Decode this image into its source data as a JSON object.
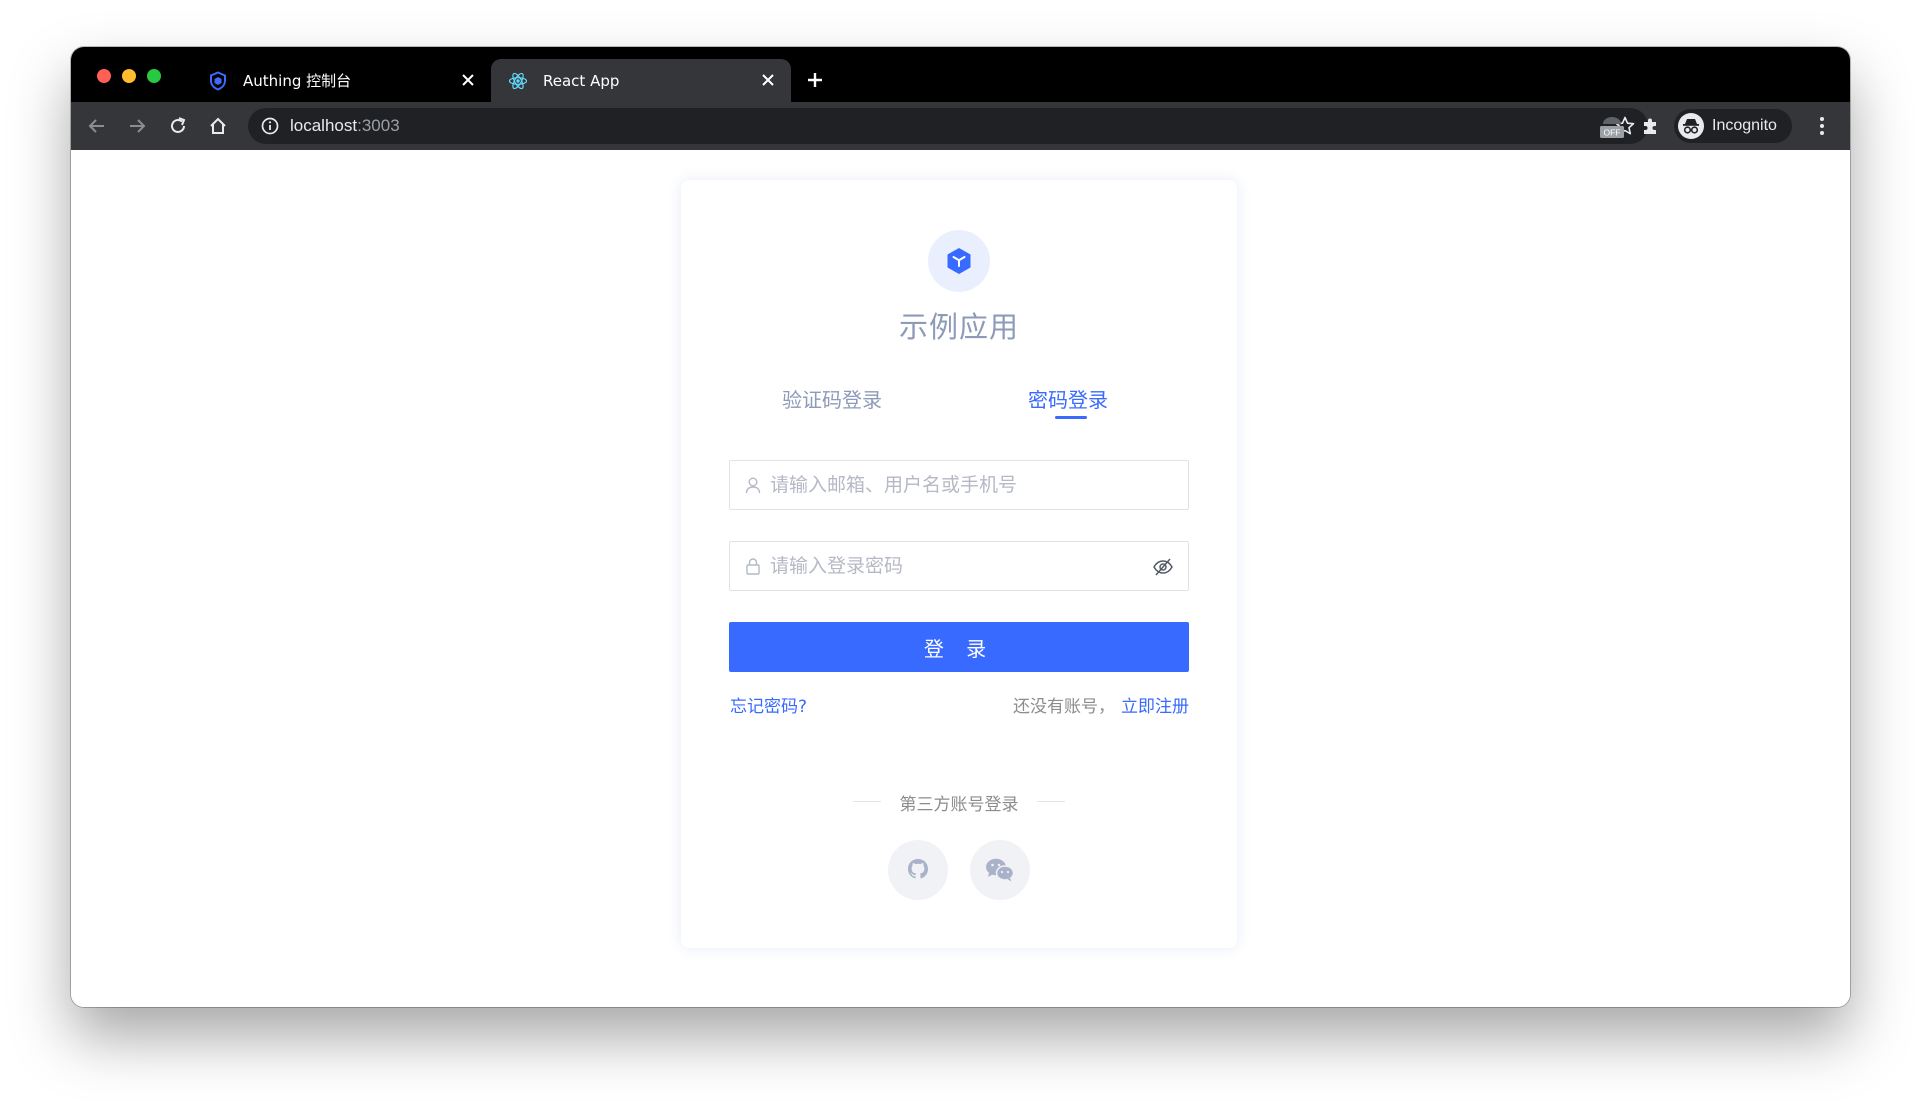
{
  "browser": {
    "tabs": [
      {
        "title": "Authing 控制台",
        "icon": "shield-icon",
        "active": false
      },
      {
        "title": "React App",
        "icon": "react-icon",
        "active": true
      }
    ],
    "url_host": "localhost",
    "url_port": ":3003",
    "profile_label": "Incognito",
    "extension_badge": "OFF"
  },
  "login": {
    "app_name": "示例应用",
    "tabs": {
      "sms": "验证码登录",
      "password": "密码登录"
    },
    "active_tab": "password",
    "username_placeholder": "请输入邮箱、用户名或手机号",
    "password_placeholder": "请输入登录密码",
    "submit_label": "登 录",
    "forgot_label": "忘记密码?",
    "no_account_label": "还没有账号，",
    "register_label": "立即注册",
    "third_party_label": "第三方账号登录",
    "social_providers": [
      "github",
      "wechat"
    ]
  },
  "colors": {
    "primary": "#396aff",
    "muted_title": "#8d9ab8",
    "tab_strip": "#000000",
    "toolbar": "#353639"
  }
}
